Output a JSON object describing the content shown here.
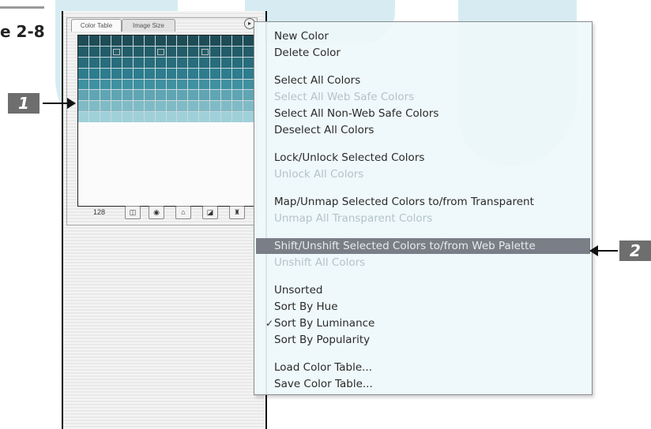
{
  "figure": {
    "label": "e 2-8"
  },
  "callouts": {
    "one": "1",
    "two": "2"
  },
  "palette": {
    "tabs": [
      "Color Table",
      "Image Size"
    ],
    "menu_button": "▸",
    "color_count": "128",
    "colors": {
      "accent_swatch": "#2f8597",
      "dark_swatch": "#1e4d57",
      "light_swatch": "#9fd0d9"
    }
  },
  "menu": {
    "items": [
      {
        "label": "New Color",
        "enabled": true
      },
      {
        "label": "Delete Color",
        "enabled": true
      },
      {
        "label": "Select All Colors",
        "enabled": true
      },
      {
        "label": "Select All Web Safe Colors",
        "enabled": false
      },
      {
        "label": "Select All Non-Web Safe Colors",
        "enabled": true
      },
      {
        "label": "Deselect All Colors",
        "enabled": true
      },
      {
        "label": "Lock/Unlock Selected Colors",
        "enabled": true
      },
      {
        "label": "Unlock All Colors",
        "enabled": false
      },
      {
        "label": "Map/Unmap Selected Colors to/from Transparent",
        "enabled": true
      },
      {
        "label": "Unmap All Transparent Colors",
        "enabled": false
      },
      {
        "label": "Shift/Unshift Selected Colors to/from Web Palette",
        "enabled": true,
        "highlighted": true
      },
      {
        "label": "Unshift All Colors",
        "enabled": false
      },
      {
        "label": "Unsorted",
        "enabled": true
      },
      {
        "label": "Sort By Hue",
        "enabled": true
      },
      {
        "label": "Sort By Luminance",
        "enabled": true,
        "checked": true,
        "check": "✓"
      },
      {
        "label": "Sort By Popularity",
        "enabled": true
      },
      {
        "label": "Load Color Table...",
        "enabled": true
      },
      {
        "label": "Save Color Table...",
        "enabled": true
      }
    ]
  }
}
